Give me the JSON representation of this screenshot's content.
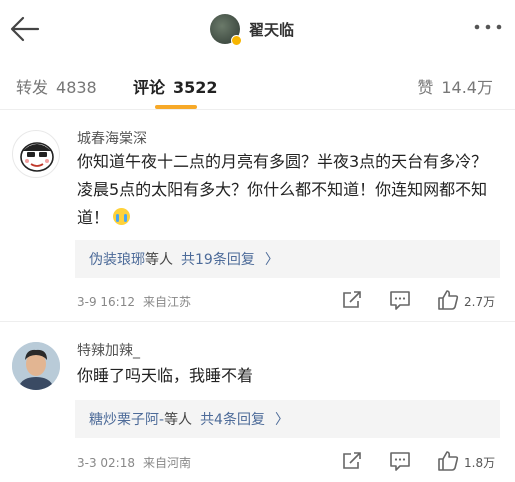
{
  "header": {
    "title": "翟天临"
  },
  "tabs": {
    "repost": {
      "label": "转发",
      "count": "4838"
    },
    "comment": {
      "label": "评论",
      "count": "3522"
    },
    "like": {
      "label": "赞",
      "count": "14.4万"
    }
  },
  "colors": {
    "accent": "#f7a928",
    "link": "#4d6b99",
    "badge": "#f7b500"
  },
  "comments": [
    {
      "user": "城春海棠深",
      "text": "你知道午夜十二点的月亮有多圆？半夜3点的天台有多冷？凌晨5点的太阳有多大？你什么都不知道！你连知网都不知道！",
      "emoji": "crying-face-icon",
      "replies": {
        "name": "伪装琅琊",
        "suffix": "等人",
        "count": "共19条回复",
        "chevron": "〉"
      },
      "date": "3-9 16:12",
      "source": "来自江苏",
      "likes": "2.7万"
    },
    {
      "user": "特辣加辣_",
      "text": "你睡了吗天临，我睡不着",
      "replies": {
        "name": "糖炒栗子阿-",
        "suffix": "等人",
        "count": "共4条回复",
        "chevron": "〉"
      },
      "date": "3-3 02:18",
      "source": "来自河南",
      "likes": "1.8万"
    }
  ]
}
